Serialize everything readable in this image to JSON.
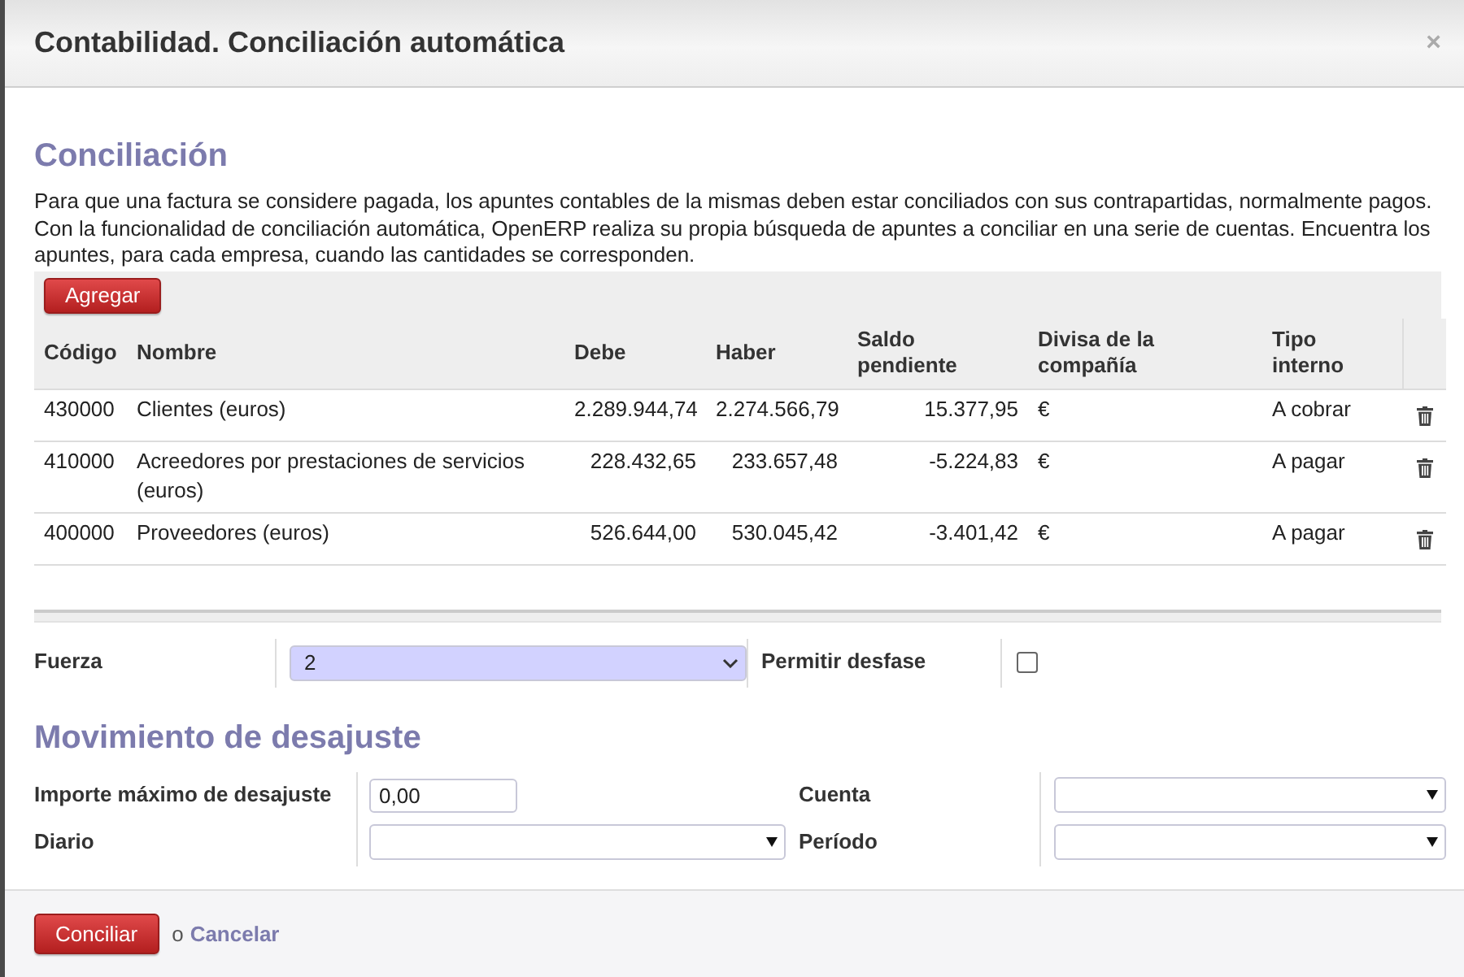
{
  "dialog": {
    "title": "Contabilidad. Conciliación automática",
    "close": "×"
  },
  "section": {
    "title": "Conciliación",
    "description": "Para que una factura se considere pagada, los apuntes contables de la mismas deben estar conciliados con sus contrapartidas, normalmente pagos. Con la funcionalidad de conciliación automática, OpenERP realiza su propia búsqueda de apuntes a conciliar en una serie de cuentas. Encuentra los apuntes, para cada empresa, cuando las cantidades se corresponden."
  },
  "table": {
    "add_button": "Agregar",
    "columns": [
      {
        "label": "Código",
        "kind": "text"
      },
      {
        "label": "Nombre",
        "kind": "text"
      },
      {
        "label": "Debe",
        "kind": "number"
      },
      {
        "label": "Haber",
        "kind": "number"
      },
      {
        "label": "Saldo pendiente",
        "kind": "number"
      },
      {
        "label": "Divisa de la compañía",
        "kind": "text"
      },
      {
        "label": "Tipo interno",
        "kind": "text"
      }
    ],
    "rows": [
      {
        "cells": [
          "430000",
          "Clientes (euros)",
          "2.289.944,74",
          "2.274.566,79",
          "15.377,95",
          "€",
          "A cobrar"
        ]
      },
      {
        "cells": [
          "410000",
          "Acreedores por prestaciones de servicios (euros)",
          "228.432,65",
          "233.657,48",
          "-5.224,83",
          "€",
          "A pagar"
        ]
      },
      {
        "cells": [
          "400000",
          "Proveedores (euros)",
          "526.644,00",
          "530.045,42",
          "-3.401,42",
          "€",
          "A pagar"
        ]
      }
    ]
  },
  "options": {
    "fields": [
      {
        "kind": "selection",
        "label": "Fuerza",
        "value": "2",
        "required": true
      },
      {
        "kind": "checkbox",
        "label": "Permitir desfase",
        "checked": false
      }
    ]
  },
  "writeoff": {
    "title": "Movimiento de desajuste",
    "fields": [
      {
        "kind": "input",
        "label": "Importe máximo de desajuste",
        "value": "0,00",
        "required": false
      },
      {
        "kind": "combo",
        "label": "Cuenta",
        "required": false
      },
      {
        "kind": "combo",
        "label": "Diario",
        "required": false
      },
      {
        "kind": "combo",
        "label": "Período",
        "required": false
      }
    ]
  },
  "footer": {
    "primary": "Conciliar",
    "separator": "o",
    "link": "Cancelar"
  }
}
